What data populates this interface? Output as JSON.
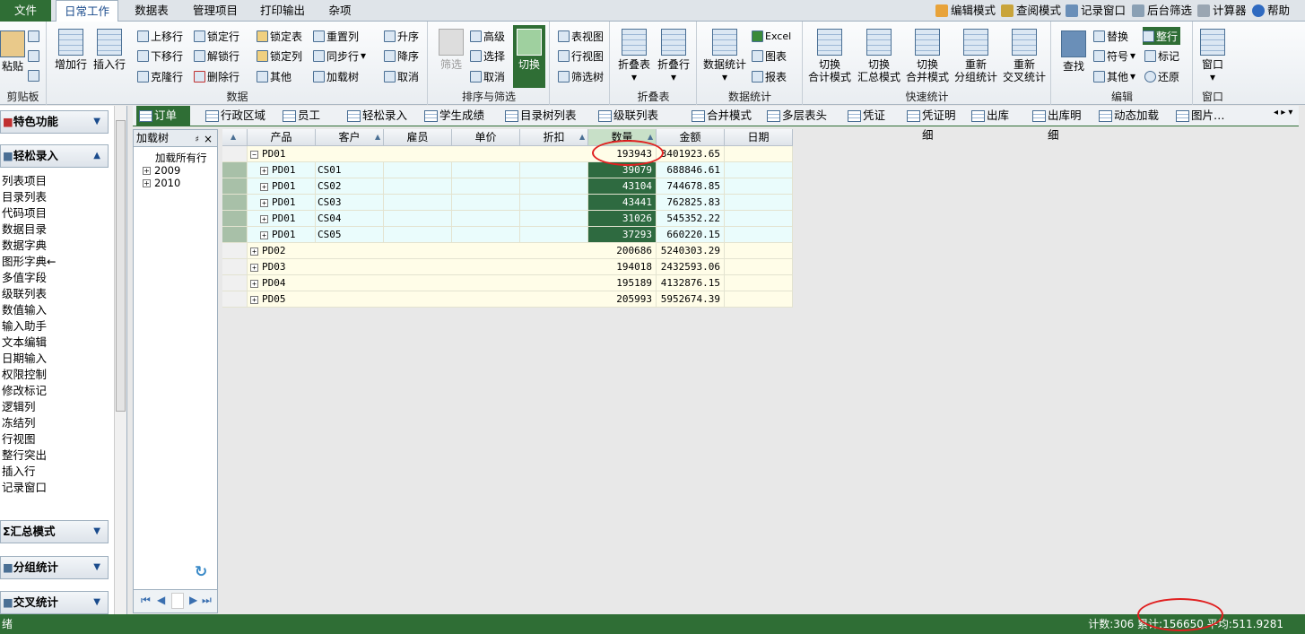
{
  "menu": {
    "tabs": [
      "文件",
      "日常工作",
      "数据表",
      "管理项目",
      "打印输出",
      "杂项"
    ],
    "right": [
      "编辑模式",
      "查阅模式",
      "记录窗口",
      "后台筛选",
      "计算器",
      "帮助"
    ]
  },
  "ribbon": {
    "clipboard": {
      "label": "剪贴板",
      "paste": "粘贴"
    },
    "data": {
      "label": "数据",
      "add_row": "增加行",
      "insert_row": "插入行",
      "move_up": "上移行",
      "move_down": "下移行",
      "clone_row": "克隆行",
      "lock_row": "锁定行",
      "unlock_row": "解锁行",
      "delete_row": "删除行",
      "lock_table": "锁定表",
      "lock_col": "锁定列",
      "other": "其他",
      "reset_col": "重置列",
      "sync_row": "同步行",
      "load_tree": "加载树"
    },
    "sort": {
      "label": "排序与筛选",
      "asc": "升序",
      "desc": "降序",
      "cancel": "取消",
      "filter": "筛选",
      "advanced": "高级",
      "select": "选择",
      "cancel2": "取消",
      "switch": "切换",
      "table_view": "表视图",
      "row_view": "行视图",
      "filter_tree": "筛选树"
    },
    "fold": {
      "label": "折叠表",
      "fold_table": "折叠表",
      "fold_row": "折叠行"
    },
    "stats": {
      "label": "数据统计",
      "data_stats": "数据统计",
      "excel": "Excel",
      "chart": "图表",
      "report": "报表"
    },
    "quick": {
      "label": "快速统计",
      "b1": [
        "切换",
        "合计模式"
      ],
      "b2": [
        "切换",
        "汇总模式"
      ],
      "b3": [
        "切换",
        "合并模式"
      ],
      "b4": [
        "重新",
        "分组统计"
      ],
      "b5": [
        "重新",
        "交叉统计"
      ]
    },
    "edit": {
      "label": "编辑",
      "find": "查找",
      "replace": "替换",
      "symbol": "符号",
      "other": "其他",
      "whole_row": "整行",
      "mark": "标记",
      "restore": "还原"
    },
    "window": {
      "label": "窗口",
      "window": "窗口"
    }
  },
  "nav": {
    "feature": "特色功能",
    "easy_entry": "轻松录入",
    "items": [
      "列表项目",
      "目录列表",
      "代码项目",
      "数据目录",
      "数据字典",
      "图形字典←",
      "多值字段",
      "级联列表",
      "数值输入",
      "输入助手",
      "文本编辑",
      "日期输入",
      "权限控制",
      "修改标记",
      "逻辑列",
      "冻结列",
      "行视图",
      "整行突出",
      "插入行",
      "记录窗口"
    ],
    "summary": "汇总模式",
    "group": "分组统计",
    "cross": "交叉统计"
  },
  "tree": {
    "title": "加载树",
    "pin": "ㅁ",
    "close": "×",
    "nodes": [
      "加载所有行",
      "2009",
      "2010"
    ]
  },
  "doc_tabs": [
    "订单",
    "行政区域",
    "员工",
    "轻松录入",
    "学生成绩",
    "目录树列表",
    "级联列表",
    "合并模式",
    "多层表头",
    "凭证",
    "凭证明细",
    "出库",
    "出库明细",
    "动态加载",
    "图片…"
  ],
  "grid": {
    "columns": [
      "产品",
      "客户",
      "雇员",
      "单价",
      "折扣",
      "数量",
      "金额",
      "日期"
    ],
    "rows": [
      {
        "product": "PD01",
        "customer": "",
        "qty": "193943",
        "amount": "3401923.65",
        "level": 0,
        "expanded": true
      },
      {
        "product": "PD01",
        "customer": "CS01",
        "qty": "39079",
        "amount": "688846.61",
        "level": 1
      },
      {
        "product": "PD01",
        "customer": "CS02",
        "qty": "43104",
        "amount": "744678.85",
        "level": 1
      },
      {
        "product": "PD01",
        "customer": "CS03",
        "qty": "43441",
        "amount": "762825.83",
        "level": 1
      },
      {
        "product": "PD01",
        "customer": "CS04",
        "qty": "31026",
        "amount": "545352.22",
        "level": 1
      },
      {
        "product": "PD01",
        "customer": "CS05",
        "qty": "37293",
        "amount": "660220.15",
        "level": 1
      },
      {
        "product": "PD02",
        "customer": "",
        "qty": "200686",
        "amount": "5240303.29",
        "level": 0
      },
      {
        "product": "PD03",
        "customer": "",
        "qty": "194018",
        "amount": "2432593.06",
        "level": 0
      },
      {
        "product": "PD04",
        "customer": "",
        "qty": "195189",
        "amount": "4132876.15",
        "level": 0
      },
      {
        "product": "PD05",
        "customer": "",
        "qty": "205993",
        "amount": "5952674.39",
        "level": 0
      }
    ]
  },
  "status": {
    "left": "绪",
    "right": "计数:306 累计:156650 平均:511.9281"
  },
  "colors": {
    "green": "#2f6e35",
    "selected_cell": "#2e6a40",
    "group_row": "#fffde8",
    "child_row": "#eafcfc"
  }
}
